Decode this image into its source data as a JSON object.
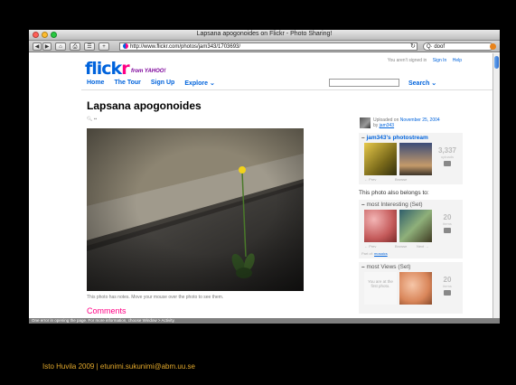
{
  "browser": {
    "title": "Lapsana apogonoides on Flickr - Photo Sharing!",
    "url": "http://www.flickr.com/photos/jam343/1703693/",
    "search_value": "doof",
    "status": "One error in opening the page. For more information, choose Window > Activity.",
    "traffic_light_colors": [
      "#ff5f57",
      "#febc2e",
      "#28c840"
    ]
  },
  "site": {
    "logo_flick": "flick",
    "logo_r": "r",
    "from_yahoo": "from YAHOO!",
    "not_signed_in": "You aren't signed in",
    "sign_in": "Sign In",
    "help": "Help",
    "nav": [
      "Home",
      "The Tour",
      "Sign Up",
      "Explore ⌄"
    ],
    "search_label": "Search ⌄",
    "brand_blue": "#0063dc",
    "brand_pink": "#ff0084"
  },
  "photo": {
    "title": "Lapsana apogonoides",
    "note": "This photo has notes. Move your mouse over the photo to see them.",
    "comments_heading": "Comments"
  },
  "sidebar": {
    "uploaded_prefix": "Uploaded on",
    "uploaded_date": "November 25, 2004",
    "by_prefix": "by",
    "by_user": "jam343",
    "photostream": {
      "title": "jam343's photostream",
      "count": "3,337",
      "count_label": "uploads",
      "prev": "← Prev",
      "browse": "Browse"
    },
    "belongs_to": "This photo also belongs to:",
    "set1": {
      "title": "most Interesting (Set)",
      "count": "20",
      "count_label": "items",
      "prev": "← Prev",
      "browse": "Browse",
      "next": "Next →",
      "part_of": "Part of:",
      "part_of_link": "mosaics"
    },
    "set2": {
      "title": "most Views (Set)",
      "count": "20",
      "count_label": "items",
      "first_note": "You are at the first photo."
    }
  },
  "footer": {
    "credit": "Isto Huvila 2009 | etunimi.sukunimi@abm.uu.se",
    "credit_color": "#e2a82b"
  }
}
